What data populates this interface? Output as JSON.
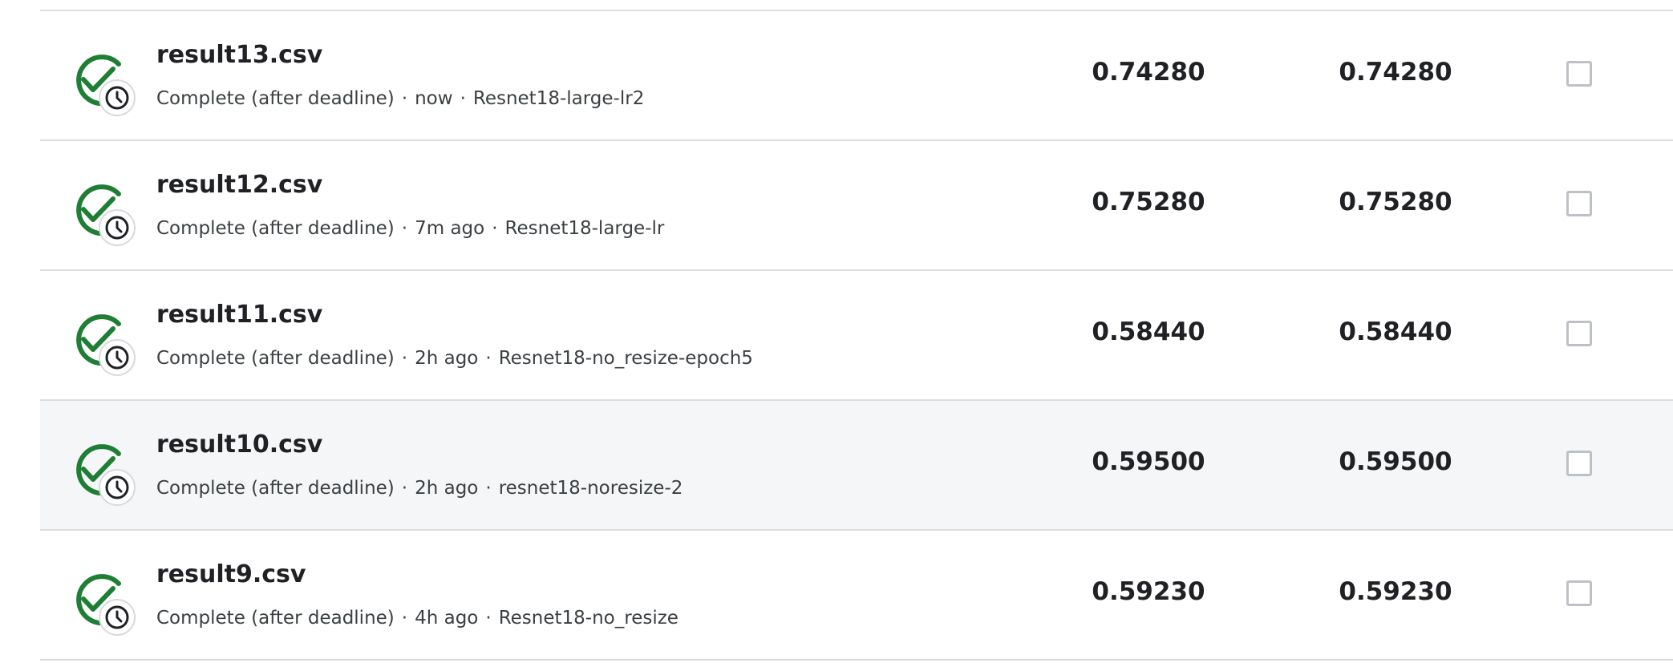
{
  "colors": {
    "success_green": "#1e7e34",
    "divider": "#dadce0",
    "hover_row": "#f5f6f7",
    "checkbox_border": "#bdc1c6"
  },
  "submissions": [
    {
      "file": "result13.csv",
      "status": "Complete (after deadline)",
      "time": "now",
      "description": "Resnet18-large-lr2",
      "private_score": "0.74280",
      "public_score": "0.74280",
      "selected": false
    },
    {
      "file": "result12.csv",
      "status": "Complete (after deadline)",
      "time": "7m ago",
      "description": "Resnet18-large-lr",
      "private_score": "0.75280",
      "public_score": "0.75280",
      "selected": false
    },
    {
      "file": "result11.csv",
      "status": "Complete (after deadline)",
      "time": "2h ago",
      "description": "Resnet18-no_resize-epoch5",
      "private_score": "0.58440",
      "public_score": "0.58440",
      "selected": false
    },
    {
      "file": "result10.csv",
      "status": "Complete (after deadline)",
      "time": "2h ago",
      "description": "resnet18-noresize-2",
      "private_score": "0.59500",
      "public_score": "0.59500",
      "selected": false
    },
    {
      "file": "result9.csv",
      "status": "Complete (after deadline)",
      "time": "4h ago",
      "description": "Resnet18-no_resize",
      "private_score": "0.59230",
      "public_score": "0.59230",
      "selected": false
    }
  ]
}
